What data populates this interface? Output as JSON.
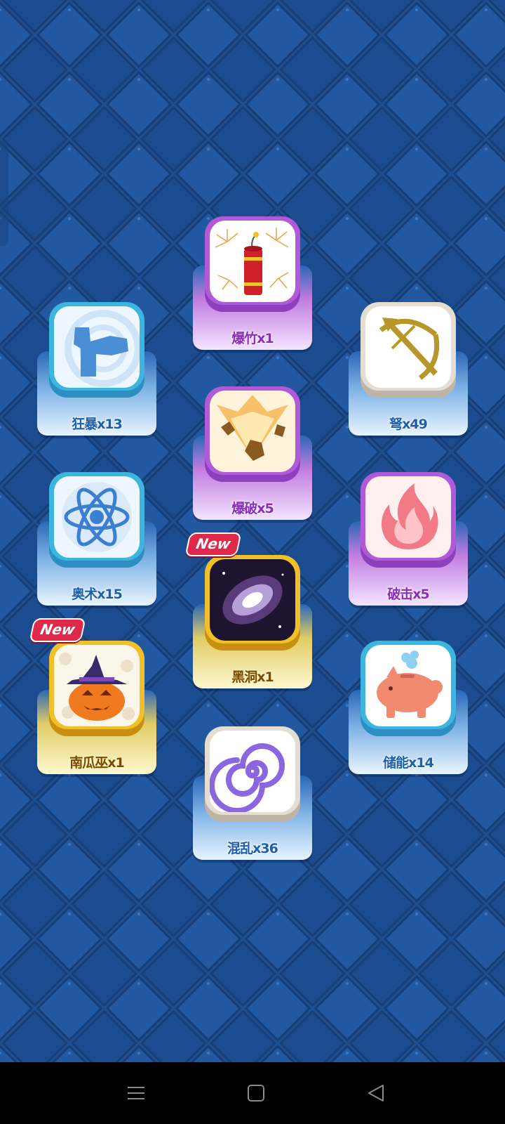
{
  "items": [
    {
      "name": "爆竹x1",
      "icon": "firecracker-icon",
      "style": "purple"
    },
    {
      "name": "狂暴x13",
      "icon": "hammer-icon",
      "style": "blue"
    },
    {
      "name": "弩x49",
      "icon": "crossbow-icon",
      "style": "blue"
    },
    {
      "name": "爆破x5",
      "icon": "explosion-icon",
      "style": "purple"
    },
    {
      "name": "奥术x15",
      "icon": "atom-icon",
      "style": "blue"
    },
    {
      "name": "破击x5",
      "icon": "flame-icon",
      "style": "purple"
    },
    {
      "name": "黑洞x1",
      "icon": "black-hole-icon",
      "style": "gold",
      "badge": "New"
    },
    {
      "name": "南瓜巫x1",
      "icon": "pumpkin-witch-icon",
      "style": "gold",
      "badge": "New"
    },
    {
      "name": "储能x14",
      "icon": "piggy-bank-icon",
      "style": "blue"
    },
    {
      "name": "混乱x36",
      "icon": "spiral-icon",
      "style": "blue"
    }
  ],
  "colors": {
    "background": "#1d4f93",
    "blue_label": "#1b5fae",
    "purple_label": "#8b2cc0",
    "gold_label": "#7a4a00"
  },
  "navbar": {
    "menu_icon": "menu-icon",
    "home_icon": "home-square-icon",
    "back_icon": "back-triangle-icon"
  }
}
